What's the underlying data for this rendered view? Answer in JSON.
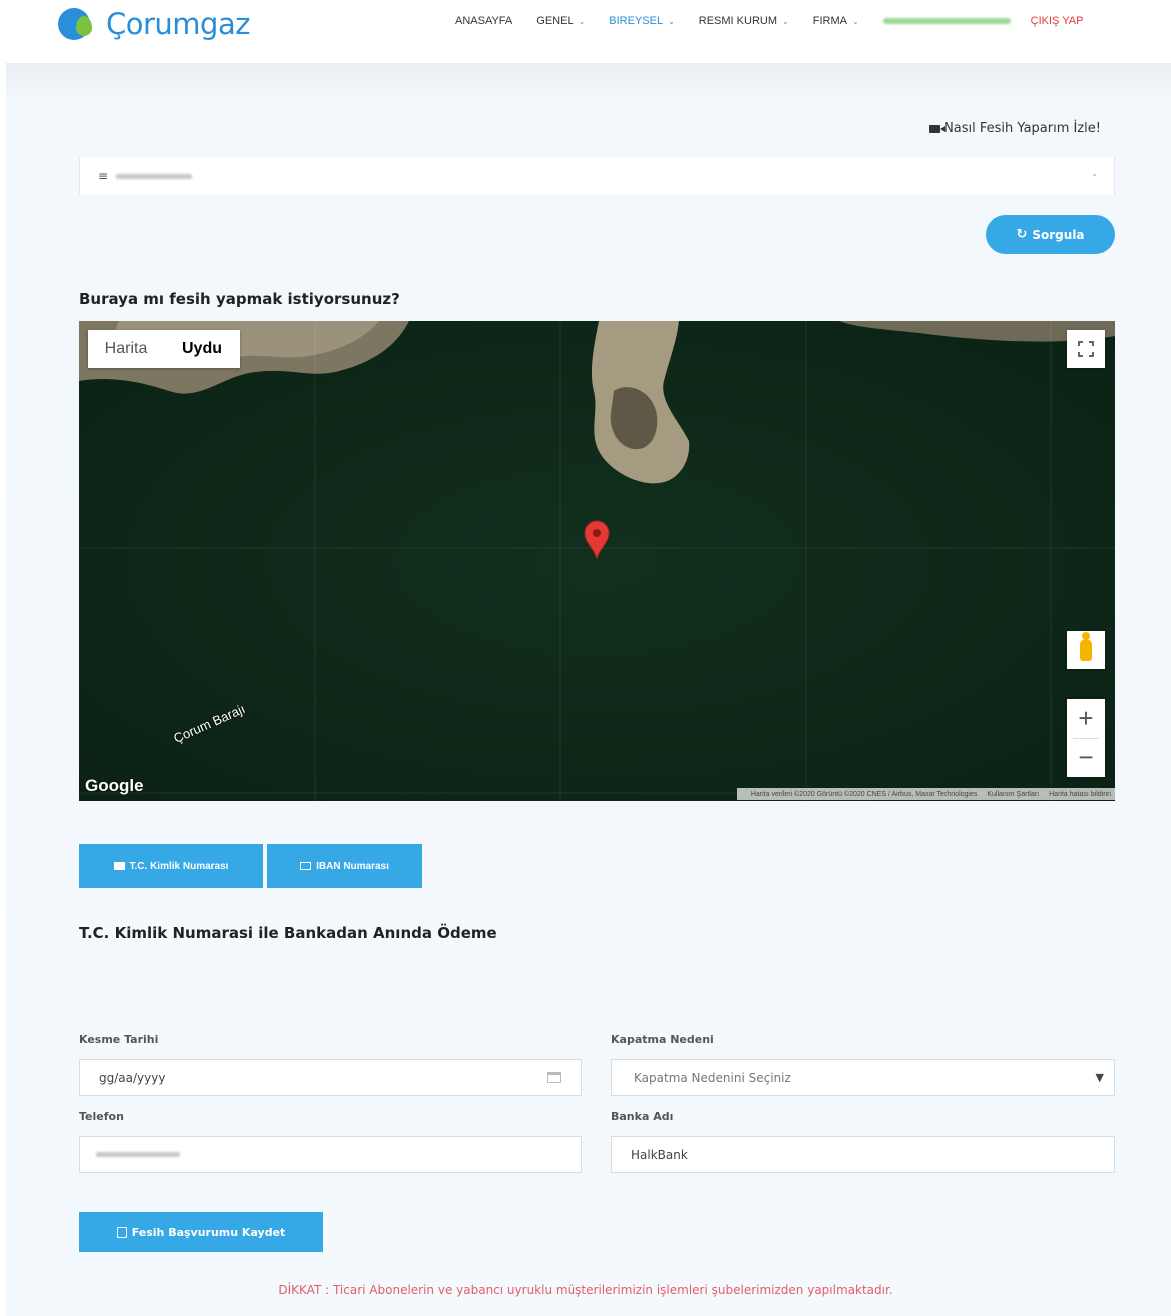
{
  "header": {
    "logo_text": "Çorumgaz",
    "nav": [
      {
        "label": "ANASAYFA",
        "has_dropdown": false,
        "active": false
      },
      {
        "label": "GENEL",
        "has_dropdown": true,
        "active": false
      },
      {
        "label": "BIREYSEL",
        "has_dropdown": true,
        "active": true
      },
      {
        "label": "RESMI KURUM",
        "has_dropdown": true,
        "active": false
      },
      {
        "label": "FIRMA",
        "has_dropdown": true,
        "active": false
      }
    ],
    "logout_label": "ÇIKIŞ YAP"
  },
  "video_link": "Nasıl Fesih Yaparım İzle!",
  "query_button": "Sorgula",
  "map_section": {
    "title": "Buraya mı fesih yapmak istiyorsunuz?",
    "toggle": {
      "map_label": "Harita",
      "satellite_label": "Uydu",
      "selected": "Uydu"
    },
    "place_label": "Çorum Barajı",
    "google_logo": "Google",
    "footer": {
      "attribution": "Harita verileri ©2020 Görüntü ©2020 CNES / Airbus, Maxar Technologies",
      "terms": "Kullanım Şartları",
      "report": "Harita hatası bildirin"
    },
    "zoom_in": "+",
    "zoom_out": "−"
  },
  "tabs": [
    {
      "label": "T.C. Kimlik Numarası",
      "icon": "id-card-icon"
    },
    {
      "label": "IBAN Numarası",
      "icon": "credit-card-icon"
    }
  ],
  "form": {
    "title": "T.C. Kimlik Numarasi ile Bankadan Anında Ödeme",
    "cut_date_label": "Kesme Tarihi",
    "cut_date_placeholder": "gg/aa/yyyy",
    "reason_label": "Kapatma Nedeni",
    "reason_placeholder": "Kapatma Nedenini Seçiniz",
    "phone_label": "Telefon",
    "bank_label": "Banka Adı",
    "bank_value": "HalkBank",
    "save_button": "Fesih Başvurumu Kaydet"
  },
  "warning": "DİKKAT : Ticari Abonelerin ve yabancı uyruklu müşterilerimizin işlemleri şubelerimizden yapılmaktadır.",
  "colors": {
    "brand_blue": "#2a8fd8",
    "brand_green": "#7cc142",
    "button_blue": "#37a8e6",
    "logout_red": "#e53935",
    "warning_red": "#e35d6a"
  }
}
